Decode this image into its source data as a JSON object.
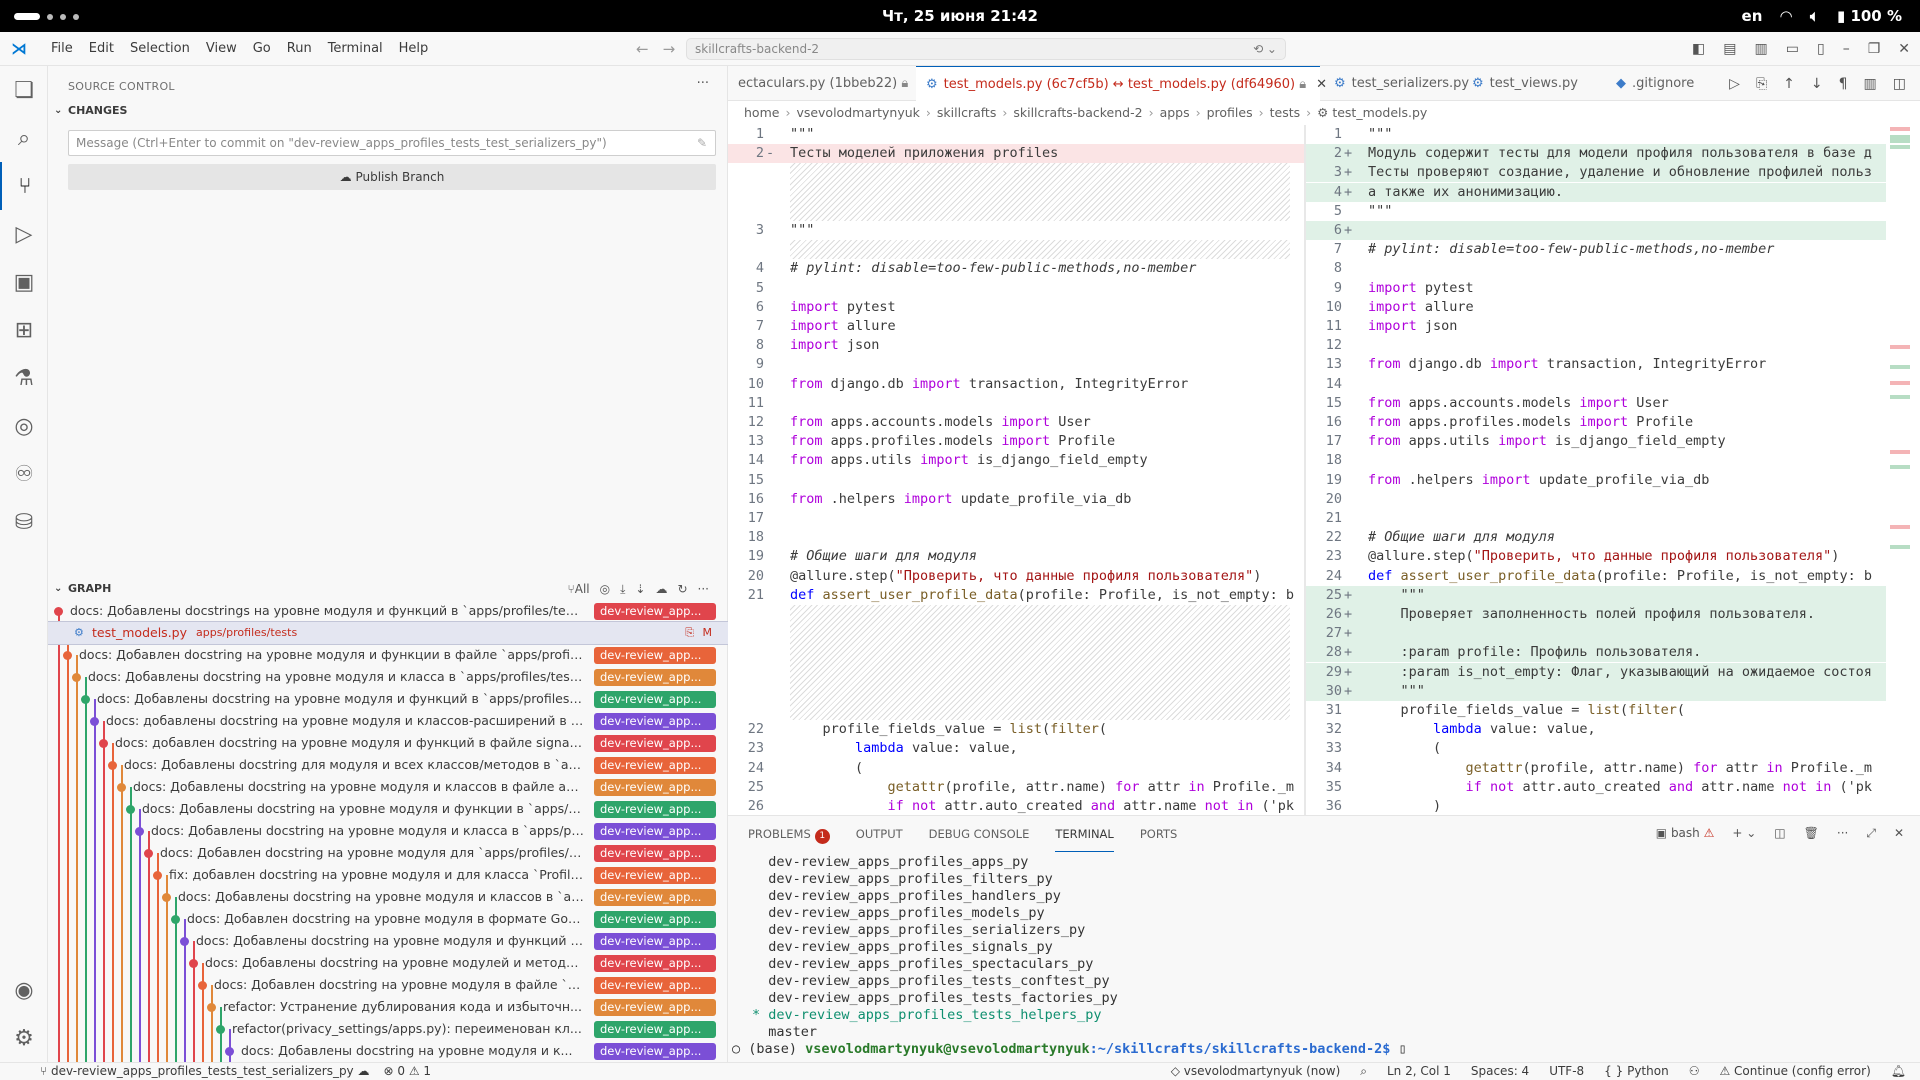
{
  "os_bar": {
    "clock": "Чт, 25 июня  21:42",
    "lang": "en",
    "battery": "100 %"
  },
  "title_bar": {
    "menu": [
      "File",
      "Edit",
      "Selection",
      "View",
      "Go",
      "Run",
      "Terminal",
      "Help"
    ],
    "command_center": "skillcrafts-backend-2"
  },
  "sidebar": {
    "header": "SOURCE CONTROL",
    "changes_label": "CHANGES",
    "commit_placeholder": "Message (Ctrl+Enter to commit on \"dev-review_apps_profiles_tests_test_serializers_py\")",
    "publish_label": "Publish Branch",
    "graph_label": "GRAPH",
    "graph_all": "All",
    "graph_rows": [
      {
        "text": "docs: Добавлены docstrings на уровне модуля и функций в `apps/profiles/tests/test_...",
        "tag": "dev-review_app...",
        "tagColor": "#e0454c",
        "dot": "#e0454c",
        "indent": 0
      },
      {
        "text": "test_models.py",
        "path": "apps/profiles/tests",
        "status": "M",
        "file": true,
        "indent": 1
      },
      {
        "text": "docs: Добавлен docstring на уровне модуля и функции в файле `apps/profiles/tests...",
        "tag": "dev-review_app...",
        "tagColor": "#e8643a",
        "dot": "#e8643a",
        "indent": 1
      },
      {
        "text": "docs: Добавлены docstring на уровне модуля и класса в `apps/profiles/tests/facto...",
        "tag": "dev-review_app...",
        "tagColor": "#e0883a",
        "dot": "#e0883a",
        "indent": 2
      },
      {
        "text": "docs: Добавлены docstring на уровне модуля и функций в `apps/profiles/tests/c...",
        "tag": "dev-review_app...",
        "tagColor": "#2ea56a",
        "dot": "#2ea56a",
        "indent": 3
      },
      {
        "text": "docs: добавлены docstring на уровне модуля и классов-расширений в `apps/...",
        "tag": "dev-review_app...",
        "tagColor": "#7b4fd6",
        "dot": "#7b4fd6",
        "indent": 4
      },
      {
        "text": "docs: добавлен docstring на уровне модуля и функций в файле signals.py  vs...",
        "tag": "dev-review_app...",
        "tagColor": "#e0454c",
        "dot": "#e0454c",
        "indent": 5
      },
      {
        "text": "docs: Добавлены docstring для модуля и всех классов/методов в `apps/pr...",
        "tag": "dev-review_app...",
        "tagColor": "#e8643a",
        "dot": "#e8643a",
        "indent": 6
      },
      {
        "text": "docs: Добавлены docstring на уровне модуля и классов в файле apps/pr...",
        "tag": "dev-review_app...",
        "tagColor": "#e0883a",
        "dot": "#e0883a",
        "indent": 7
      },
      {
        "text": "docs: Добавлены docstring на уровне модуля и функции в `apps/profil...",
        "tag": "dev-review_app...",
        "tagColor": "#2ea56a",
        "dot": "#2ea56a",
        "indent": 8
      },
      {
        "text": "docs: Добавлены docstring на уровне модуля и класса в `apps/profil...",
        "tag": "dev-review_app...",
        "tagColor": "#7b4fd6",
        "dot": "#7b4fd6",
        "indent": 9
      },
      {
        "text": "docs: Добавлен docstring на уровне модуля для `apps/profiles/app...",
        "tag": "dev-review_app...",
        "tagColor": "#e0454c",
        "dot": "#e0454c",
        "indent": 10
      },
      {
        "text": "fix: добавлен docstring на уровне модуля и для класса `ProfileBla...",
        "tag": "dev-review_app...",
        "tagColor": "#e8643a",
        "dot": "#e8643a",
        "indent": 11
      },
      {
        "text": "docs: Добавлены docstring на уровне модуля и классов в `apps...",
        "tag": "dev-review_app...",
        "tagColor": "#e0883a",
        "dot": "#e0883a",
        "indent": 12
      },
      {
        "text": "docs: Добавлен docstring на уровне модуля в формате Googl...",
        "tag": "dev-review_app...",
        "tagColor": "#2ea56a",
        "dot": "#2ea56a",
        "indent": 13
      },
      {
        "text": "docs: Добавлены docstring на уровне модуля и функций в `...",
        "tag": "dev-review_app...",
        "tagColor": "#7b4fd6",
        "dot": "#7b4fd6",
        "indent": 14
      },
      {
        "text": "docs: Добавлены docstring на уровне модулей и методов в...",
        "tag": "dev-review_app...",
        "tagColor": "#e0454c",
        "dot": "#e0454c",
        "indent": 15
      },
      {
        "text": "docs: Добавлен docstring на уровне модуля в файле `a...",
        "tag": "dev-review_app...",
        "tagColor": "#e8643a",
        "dot": "#e8643a",
        "indent": 16
      },
      {
        "text": "refactor: Устранение дублирования кода и избыточн...",
        "tag": "dev-review_app...",
        "tagColor": "#e0883a",
        "dot": "#e0883a",
        "indent": 17
      },
      {
        "text": "refactor(privacy_settings/apps.py): переименован кл...",
        "tag": "dev-review_app...",
        "tagColor": "#2ea56a",
        "dot": "#2ea56a",
        "indent": 18
      },
      {
        "text": "docs: Добавлены docstring на уровне модуля и к...",
        "tag": "dev-review_app...",
        "tagColor": "#7b4fd6",
        "dot": "#7b4fd6",
        "indent": 19
      }
    ]
  },
  "tabs": [
    {
      "label": "ectaculars.py (1bbeb22)",
      "lock": true
    },
    {
      "label": "test_models.py (6c7cf5b) ↔ test_models.py (df64960)",
      "lock": true,
      "active": true
    },
    {
      "label": "test_serializers.py"
    },
    {
      "label": "test_views.py"
    },
    {
      "label": ".gitignore"
    }
  ],
  "breadcrumbs": [
    "home",
    "vsevolodmartynyuk",
    "skillcrafts",
    "skillcrafts-backend-2",
    "apps",
    "profiles",
    "tests",
    "test_models.py"
  ],
  "diff_left": [
    {
      "n": "1",
      "t": "\"\"\""
    },
    {
      "n": "2",
      "m": "-",
      "t": "Тесты моделей приложения profiles",
      "cls": "del"
    },
    {
      "n": "",
      "hatch": 3
    },
    {
      "n": "3",
      "t": "\"\"\""
    },
    {
      "n": "",
      "hatch": 1
    },
    {
      "n": "4",
      "t": "# pylint: disable=too-few-public-methods,no-member",
      "c": "cmg"
    },
    {
      "n": "5",
      "t": ""
    },
    {
      "n": "6",
      "t": "import pytest",
      "k": "import"
    },
    {
      "n": "7",
      "t": "import allure",
      "k": "import"
    },
    {
      "n": "8",
      "t": "import json",
      "k": "import"
    },
    {
      "n": "9",
      "t": ""
    },
    {
      "n": "10",
      "t": "from django.db import transaction, IntegrityError"
    },
    {
      "n": "11",
      "t": ""
    },
    {
      "n": "12",
      "t": "from apps.accounts.models import User"
    },
    {
      "n": "13",
      "t": "from apps.profiles.models import Profile"
    },
    {
      "n": "14",
      "t": "from apps.utils import is_django_field_empty"
    },
    {
      "n": "15",
      "t": ""
    },
    {
      "n": "16",
      "t": "from .helpers import update_profile_via_db"
    },
    {
      "n": "17",
      "t": ""
    },
    {
      "n": "18",
      "t": ""
    },
    {
      "n": "19",
      "t": "# Общие шаги для модуля",
      "c": "cmg"
    },
    {
      "n": "20",
      "t": "@allure.step(\"Проверить, что данные профиля пользователя\")"
    },
    {
      "n": "21",
      "t": "def assert_user_profile_data(profile: Profile, is_not_empty: b"
    },
    {
      "n": "",
      "hatch": 6
    },
    {
      "n": "22",
      "t": "    profile_fields_value = list(filter("
    },
    {
      "n": "23",
      "t": "        lambda value: value,"
    },
    {
      "n": "24",
      "t": "        ("
    },
    {
      "n": "25",
      "t": "            getattr(profile, attr.name) for attr in Profile._m"
    },
    {
      "n": "26",
      "t": "            if not attr.auto_created and attr.name not in ('pk"
    },
    {
      "n": "27",
      "t": "        )"
    },
    {
      "n": "28",
      "t": "    ))"
    }
  ],
  "diff_right": [
    {
      "n": "1",
      "t": "\"\"\""
    },
    {
      "n": "2",
      "m": "+",
      "t": "Модуль содержит тесты для модели профиля пользователя в базе д",
      "cls": "add"
    },
    {
      "n": "3",
      "m": "+",
      "t": "Тесты проверяют создание, удаление и обновление профилей польз",
      "cls": "add"
    },
    {
      "n": "4",
      "m": "+",
      "t": "а также их анонимизацию.",
      "cls": "add"
    },
    {
      "n": "5",
      "t": "\"\"\""
    },
    {
      "n": "6",
      "m": "+",
      "t": "",
      "cls": "add"
    },
    {
      "n": "7",
      "t": "# pylint: disable=too-few-public-methods,no-member",
      "c": "cmg"
    },
    {
      "n": "8",
      "t": ""
    },
    {
      "n": "9",
      "t": "import pytest"
    },
    {
      "n": "10",
      "t": "import allure"
    },
    {
      "n": "11",
      "t": "import json"
    },
    {
      "n": "12",
      "t": ""
    },
    {
      "n": "13",
      "t": "from django.db import transaction, IntegrityError"
    },
    {
      "n": "14",
      "t": ""
    },
    {
      "n": "15",
      "t": "from apps.accounts.models import User"
    },
    {
      "n": "16",
      "t": "from apps.profiles.models import Profile"
    },
    {
      "n": "17",
      "t": "from apps.utils import is_django_field_empty"
    },
    {
      "n": "18",
      "t": ""
    },
    {
      "n": "19",
      "t": "from .helpers import update_profile_via_db"
    },
    {
      "n": "20",
      "t": ""
    },
    {
      "n": "21",
      "t": ""
    },
    {
      "n": "22",
      "t": "# Общие шаги для модуля",
      "c": "cmg"
    },
    {
      "n": "23",
      "t": "@allure.step(\"Проверить, что данные профиля пользователя\")"
    },
    {
      "n": "24",
      "t": "def assert_user_profile_data(profile: Profile, is_not_empty: b"
    },
    {
      "n": "25",
      "m": "+",
      "t": "    \"\"\"",
      "cls": "add"
    },
    {
      "n": "26",
      "m": "+",
      "t": "    Проверяет заполненность полей профиля пользователя.",
      "cls": "add"
    },
    {
      "n": "27",
      "m": "+",
      "t": "",
      "cls": "add"
    },
    {
      "n": "28",
      "m": "+",
      "t": "    :param profile: Профиль пользователя.",
      "cls": "add"
    },
    {
      "n": "29",
      "m": "+",
      "t": "    :param is_not_empty: Флаг, указывающий на ожидаемое состоя",
      "cls": "add"
    },
    {
      "n": "30",
      "m": "+",
      "t": "    \"\"\"",
      "cls": "add"
    },
    {
      "n": "31",
      "t": "    profile_fields_value = list(filter("
    },
    {
      "n": "32",
      "t": "        lambda value: value,"
    },
    {
      "n": "33",
      "t": "        ("
    },
    {
      "n": "34",
      "t": "            getattr(profile, attr.name) for attr in Profile._m"
    },
    {
      "n": "35",
      "t": "            if not attr.auto_created and attr.name not in ('pk"
    },
    {
      "n": "36",
      "t": "        )"
    },
    {
      "n": "37",
      "t": "    ))"
    }
  ],
  "panel": {
    "tabs": [
      "PROBLEMS",
      "OUTPUT",
      "DEBUG CONSOLE",
      "TERMINAL",
      "PORTS"
    ],
    "problems_count": "1",
    "active": "TERMINAL",
    "shell": "bash",
    "lines": [
      "  dev-review_apps_profiles_apps_py",
      "  dev-review_apps_profiles_filters_py",
      "  dev-review_apps_profiles_handlers_py",
      "  dev-review_apps_profiles_models_py",
      "  dev-review_apps_profiles_serializers_py",
      "  dev-review_apps_profiles_signals_py",
      "  dev-review_apps_profiles_spectaculars_py",
      "  dev-review_apps_profiles_tests_conftest_py",
      "  dev-review_apps_profiles_tests_factories_py"
    ],
    "current_branch_line": "* dev-review_apps_profiles_tests_helpers_py",
    "master_line": "  master",
    "prompt_env": "(base) ",
    "prompt_user": "vsevolodmartynyuk@vsevolodmartynyuk",
    "prompt_path": ":~/skillcrafts/skillcrafts-backend-2$ "
  },
  "status_bar": {
    "branch": "dev-review_apps_profiles_tests_test_serializers_py",
    "problems": "0",
    "warnings": "1",
    "blame": "vsevolodmartynyuk (now)",
    "position": "Ln 2, Col 1",
    "spaces": "Spaces: 4",
    "encoding": "UTF-8",
    "language": "Python",
    "continue": "Continue (config error)"
  }
}
